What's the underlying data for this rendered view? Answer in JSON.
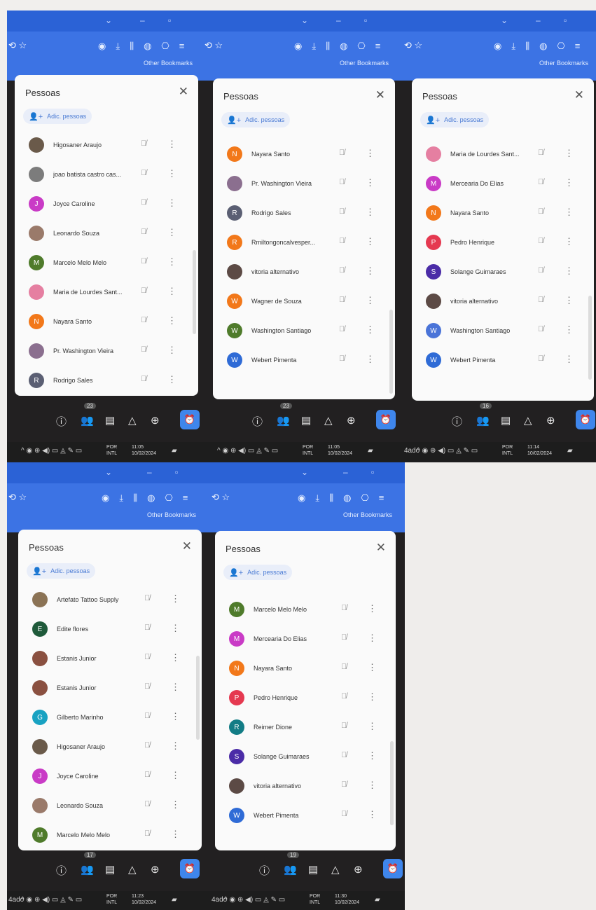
{
  "panel_title": "Pessoas",
  "add_people": "Adic. pessoas",
  "bookmarks": "Other Bookmarks",
  "lang": "POR",
  "lang2": "INTL",
  "taskbar_extra_label": "4ado",
  "panels": [
    {
      "badge": "23",
      "time": "11:05",
      "date": "10/02/2024",
      "people": [
        {
          "name": "Higosaner Araujo",
          "initial": "",
          "color": "#6a5a4a"
        },
        {
          "name": "joao batista castro cas...",
          "initial": "",
          "color": "#7c7c7c"
        },
        {
          "name": "Joyce Caroline",
          "initial": "J",
          "color": "#c93bc6"
        },
        {
          "name": "Leonardo Souza",
          "initial": "",
          "color": "#9a7a6a"
        },
        {
          "name": "Marcelo Melo Melo",
          "initial": "M",
          "color": "#4f7b2b"
        },
        {
          "name": "Maria de Lourdes Sant...",
          "initial": "",
          "color": "#e57fa1"
        },
        {
          "name": "Nayara Santo",
          "initial": "N",
          "color": "#f2781a"
        },
        {
          "name": "Pr. Washington Vieira",
          "initial": "",
          "color": "#8b6f8f"
        },
        {
          "name": "Rodrigo Sales",
          "initial": "R",
          "color": "#5b5f73"
        }
      ]
    },
    {
      "badge": "23",
      "time": "11:05",
      "date": "10/02/2024",
      "people": [
        {
          "name": "Nayara Santo",
          "initial": "N",
          "color": "#f2781a"
        },
        {
          "name": "Pr. Washington Vieira",
          "initial": "",
          "color": "#8b6f8f"
        },
        {
          "name": "Rodrigo Sales",
          "initial": "R",
          "color": "#5b5f73"
        },
        {
          "name": "Rmiltongoncalvesper...",
          "initial": "R",
          "color": "#f2781a"
        },
        {
          "name": "vitoria alternativo",
          "initial": "",
          "color": "#5c4a45"
        },
        {
          "name": "Wagner de Souza",
          "initial": "W",
          "color": "#f2781a"
        },
        {
          "name": "Washington Santiago",
          "initial": "W",
          "color": "#4f7b2b"
        },
        {
          "name": "Webert Pimenta",
          "initial": "W",
          "color": "#2f6bd6"
        }
      ]
    },
    {
      "badge": "16",
      "time": "11:14",
      "date": "10/02/2024",
      "people": [
        {
          "name": "Maria de Lourdes Sant...",
          "initial": "",
          "color": "#e57fa1"
        },
        {
          "name": "Mercearia Do Elias",
          "initial": "M",
          "color": "#c93bc6"
        },
        {
          "name": "Nayara Santo",
          "initial": "N",
          "color": "#f2781a"
        },
        {
          "name": "Pedro Henrique",
          "initial": "P",
          "color": "#e53950"
        },
        {
          "name": "Solange Guimaraes",
          "initial": "S",
          "color": "#4b2ca7"
        },
        {
          "name": "vitoria alternativo",
          "initial": "",
          "color": "#5c4a45"
        },
        {
          "name": "Washington Santiago",
          "initial": "W",
          "color": "#4a74d8"
        },
        {
          "name": "Webert Pimenta",
          "initial": "W",
          "color": "#2f6bd6"
        }
      ]
    },
    {
      "badge": "17",
      "time": "11:23",
      "date": "10/02/2024",
      "people": [
        {
          "name": "Artefato Tattoo Supply",
          "initial": "",
          "color": "#8b7355"
        },
        {
          "name": "Edite flores",
          "initial": "E",
          "color": "#1f5a3a"
        },
        {
          "name": "Estanis Junior",
          "initial": "",
          "color": "#8a5040"
        },
        {
          "name": "Estanis Junior",
          "initial": "",
          "color": "#8a5040"
        },
        {
          "name": "Gilberto Marinho",
          "initial": "G",
          "color": "#18a2c2"
        },
        {
          "name": "Higosaner Araujo",
          "initial": "",
          "color": "#6a5a4a"
        },
        {
          "name": "Joyce Caroline",
          "initial": "J",
          "color": "#c93bc6"
        },
        {
          "name": "Leonardo Souza",
          "initial": "",
          "color": "#9a7a6a"
        },
        {
          "name": "Marcelo Melo Melo",
          "initial": "M",
          "color": "#4f7b2b"
        }
      ]
    },
    {
      "badge": "19",
      "time": "11:30",
      "date": "10/02/2024",
      "people": [
        {
          "name": "Marcelo Melo Melo",
          "initial": "M",
          "color": "#4f7b2b"
        },
        {
          "name": "Mercearia Do Elias",
          "initial": "M",
          "color": "#c93bc6"
        },
        {
          "name": "Nayara Santo",
          "initial": "N",
          "color": "#f2781a"
        },
        {
          "name": "Pedro Henrique",
          "initial": "P",
          "color": "#e53950"
        },
        {
          "name": "Reimer Dione",
          "initial": "R",
          "color": "#127c85"
        },
        {
          "name": "Solange Guimaraes",
          "initial": "S",
          "color": "#4b2ca7"
        },
        {
          "name": "vitoria alternativo",
          "initial": "",
          "color": "#5c4a45"
        },
        {
          "name": "Webert Pimenta",
          "initial": "W",
          "color": "#2f6bd6"
        }
      ]
    }
  ]
}
